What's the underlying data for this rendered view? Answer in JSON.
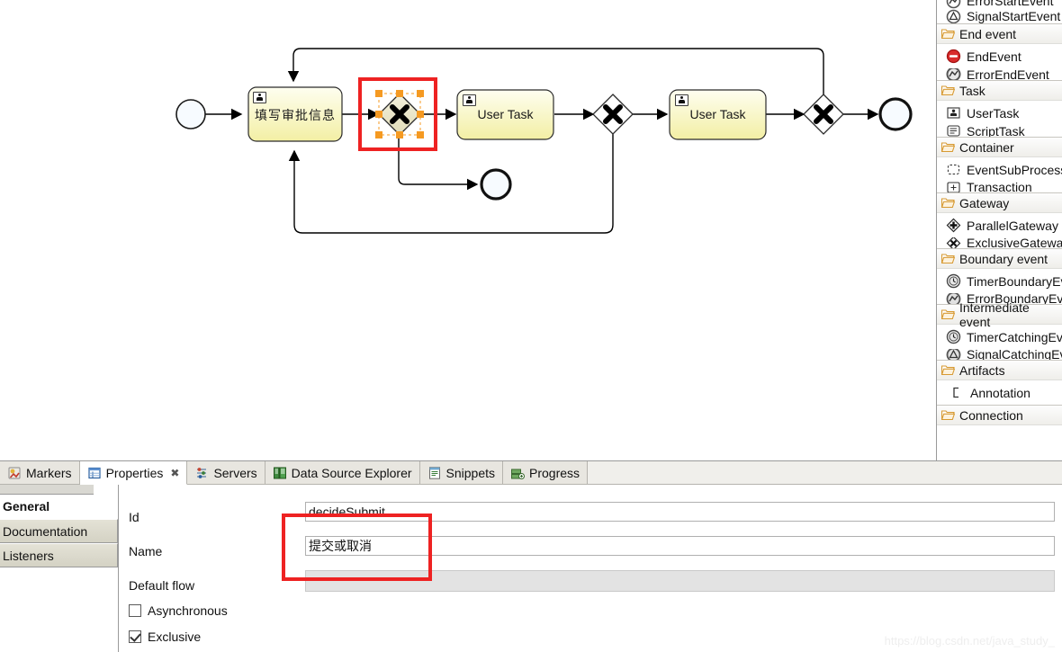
{
  "diagram": {
    "nodes": [
      {
        "id": "startEvent",
        "type": "start-event",
        "label": ""
      },
      {
        "id": "task1",
        "type": "user-task",
        "label": "填写审批信息"
      },
      {
        "id": "decideSubmit",
        "type": "exclusive-gateway",
        "label": "",
        "selected": true
      },
      {
        "id": "task2",
        "type": "user-task",
        "label": "User Task"
      },
      {
        "id": "gateway2",
        "type": "exclusive-gateway",
        "label": ""
      },
      {
        "id": "task3",
        "type": "user-task",
        "label": "User Task"
      },
      {
        "id": "gateway3",
        "type": "exclusive-gateway",
        "label": ""
      },
      {
        "id": "endEvent1",
        "type": "end-event",
        "label": ""
      },
      {
        "id": "endEvent2",
        "type": "end-event",
        "label": ""
      }
    ],
    "selection_handle_color": "#f59a22",
    "annotation_color": "#ee2222",
    "task_fill_top": "#fefee8",
    "task_fill_bottom": "#f5f2a8",
    "gateway_fill": "#e8e4c8"
  },
  "palette": {
    "drawers": [
      {
        "title": "End event",
        "items": [
          {
            "label": "EndEvent",
            "icon": "end-event-icon"
          },
          {
            "label": "ErrorEndEvent",
            "icon": "error-end-event-icon"
          }
        ]
      },
      {
        "title": "Task",
        "items": [
          {
            "label": "UserTask",
            "icon": "user-task-icon"
          },
          {
            "label": "ScriptTask",
            "icon": "script-task-icon"
          }
        ]
      },
      {
        "title": "Container",
        "items": [
          {
            "label": "EventSubProcess",
            "icon": "event-subprocess-icon"
          },
          {
            "label": "Transaction",
            "icon": "transaction-icon"
          }
        ]
      },
      {
        "title": "Gateway",
        "items": [
          {
            "label": "ParallelGateway",
            "icon": "parallel-gateway-icon"
          },
          {
            "label": "ExclusiveGateway",
            "icon": "exclusive-gateway-icon"
          }
        ]
      },
      {
        "title": "Boundary event",
        "items": [
          {
            "label": "TimerBoundaryEvent",
            "icon": "timer-boundary-event-icon"
          },
          {
            "label": "ErrorBoundaryEvent",
            "icon": "error-boundary-event-icon"
          }
        ]
      },
      {
        "title": "Intermediate event",
        "items": [
          {
            "label": "TimerCatchingEvent",
            "icon": "timer-catching-event-icon"
          },
          {
            "label": "SignalCatchingEvent",
            "icon": "signal-catching-event-icon"
          }
        ]
      },
      {
        "title": "Artifacts",
        "items": [
          {
            "label": "Annotation",
            "icon": "annotation-icon"
          }
        ]
      },
      {
        "title": "Connection",
        "items": []
      }
    ],
    "top_clipped": [
      {
        "label": "ErrorStartEvent",
        "icon": "error-start-event-icon"
      },
      {
        "label": "SignalStartEvent",
        "icon": "signal-start-event-icon"
      }
    ]
  },
  "view_tabs": [
    {
      "label": "Markers",
      "icon": "markers-icon",
      "active": false,
      "closable": false
    },
    {
      "label": "Properties",
      "icon": "properties-icon",
      "active": true,
      "closable": true
    },
    {
      "label": "Servers",
      "icon": "servers-icon",
      "active": false,
      "closable": false
    },
    {
      "label": "Data Source Explorer",
      "icon": "data-source-explorer-icon",
      "active": false,
      "closable": false
    },
    {
      "label": "Snippets",
      "icon": "snippets-icon",
      "active": false,
      "closable": false
    },
    {
      "label": "Progress",
      "icon": "progress-icon",
      "active": false,
      "closable": false
    }
  ],
  "properties": {
    "tabs": [
      {
        "label": "General",
        "selected": true
      },
      {
        "label": "Documentation",
        "selected": false
      },
      {
        "label": "Listeners",
        "selected": false
      }
    ],
    "fields": {
      "id_label": "Id",
      "id_value": "decideSubmit",
      "name_label": "Name",
      "name_value": "提交或取消",
      "default_flow_label": "Default flow",
      "default_flow_value": "",
      "asynchronous_label": "Asynchronous",
      "asynchronous_checked": false,
      "exclusive_label": "Exclusive",
      "exclusive_checked": true
    }
  },
  "watermark": "https://blog.csdn.net/java_study_"
}
